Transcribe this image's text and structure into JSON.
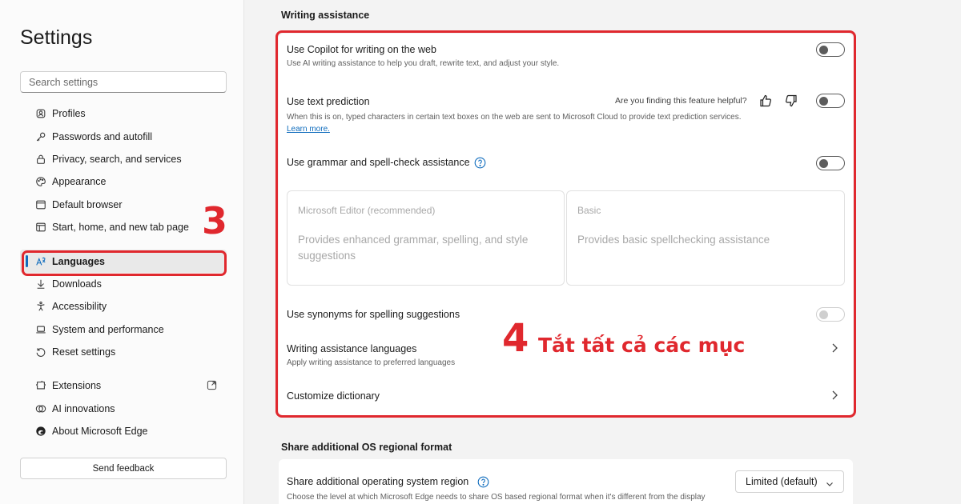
{
  "sidebar": {
    "title": "Settings",
    "search_placeholder": "Search settings",
    "items": [
      {
        "label": "Profiles",
        "icon": "profile-icon"
      },
      {
        "label": "Passwords and autofill",
        "icon": "key-icon"
      },
      {
        "label": "Privacy, search, and services",
        "icon": "lock-icon"
      },
      {
        "label": "Appearance",
        "icon": "palette-icon"
      },
      {
        "label": "Default browser",
        "icon": "browser-icon"
      },
      {
        "label": "Start, home, and new tab page",
        "icon": "home-icon"
      },
      {
        "label": "Languages",
        "icon": "languages-icon",
        "active": true
      },
      {
        "label": "Downloads",
        "icon": "download-icon"
      },
      {
        "label": "Accessibility",
        "icon": "accessibility-icon"
      },
      {
        "label": "System and performance",
        "icon": "laptop-icon"
      },
      {
        "label": "Reset settings",
        "icon": "reset-icon"
      },
      {
        "label": "Extensions",
        "icon": "extensions-icon"
      },
      {
        "label": "AI innovations",
        "icon": "ai-icon"
      },
      {
        "label": "About Microsoft Edge",
        "icon": "edge-icon"
      }
    ],
    "send_feedback": "Send feedback"
  },
  "annotations": {
    "step3": "3",
    "step4": "4",
    "step4_text": "Tắt tất cả các mục",
    "accent_color": "#e0282e"
  },
  "writing_assistance": {
    "heading": "Writing assistance",
    "copilot": {
      "title": "Use Copilot for writing on the web",
      "desc": "Use AI writing assistance to help you draft, rewrite text, and adjust your style.",
      "enabled": false
    },
    "text_prediction": {
      "title": "Use text prediction",
      "feedback_question": "Are you finding this feature helpful?",
      "desc": "When this is on, typed characters in certain text boxes on the web are sent to Microsoft Cloud to provide text prediction services.",
      "learn_more": "Learn more.",
      "enabled": false
    },
    "grammar": {
      "title": "Use grammar and spell-check assistance",
      "enabled": false,
      "options": [
        {
          "title": "Microsoft Editor (recommended)",
          "desc": "Provides enhanced grammar, spelling, and style suggestions"
        },
        {
          "title": "Basic",
          "desc": "Provides basic spellchecking assistance"
        }
      ]
    },
    "synonyms": {
      "title": "Use synonyms for spelling suggestions",
      "enabled": false,
      "disabled": true
    },
    "languages": {
      "title": "Writing assistance languages",
      "desc": "Apply writing assistance to preferred languages"
    },
    "dictionary": {
      "title": "Customize dictionary"
    }
  },
  "regional": {
    "heading": "Share additional OS regional format",
    "title": "Share additional operating system region",
    "desc": "Choose the level at which Microsoft Edge needs to share OS based regional format when it's different from the display",
    "select_value": "Limited (default)"
  }
}
